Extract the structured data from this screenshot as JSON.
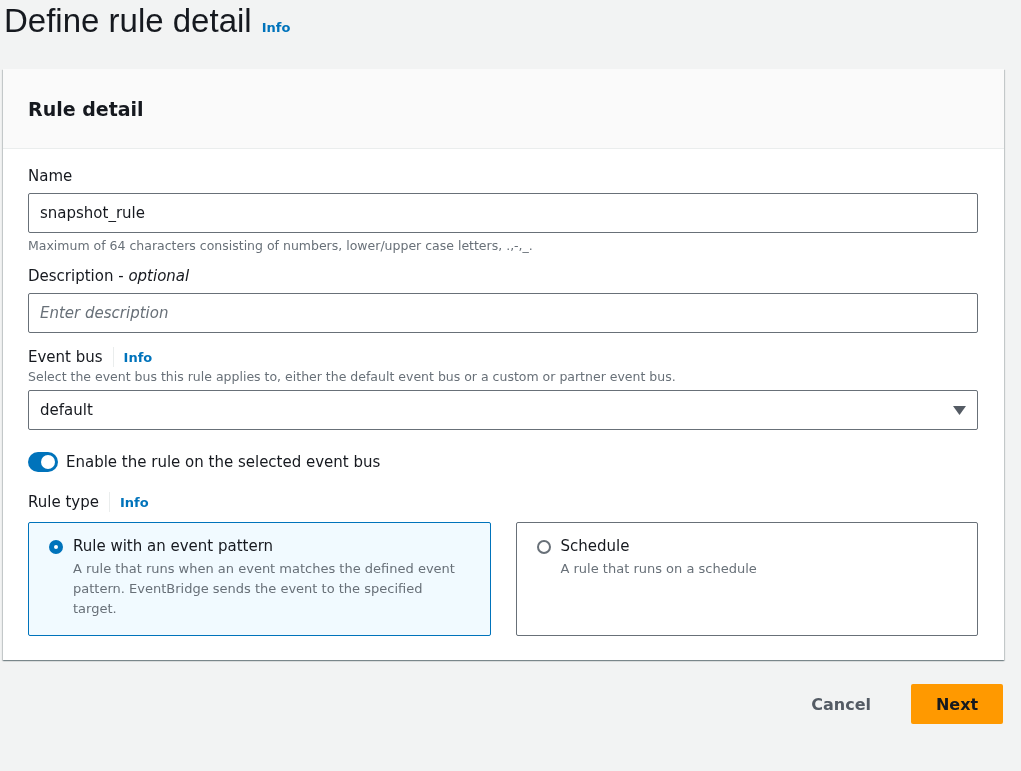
{
  "page": {
    "title": "Define rule detail",
    "info_link": "Info"
  },
  "card": {
    "title": "Rule detail",
    "name": {
      "label": "Name",
      "value": "snapshot_rule",
      "hint": "Maximum of 64 characters consisting of numbers, lower/upper case letters, .,-,_."
    },
    "description": {
      "label": "Description - *optional*",
      "placeholder": "Enter description"
    },
    "event_bus": {
      "label": "Event bus",
      "info_link": "Info",
      "hint": "Select the event bus this rule applies to, either the default event bus or a custom or partner event bus.",
      "value": "default"
    },
    "enable_toggle": {
      "label": "Enable the rule on the selected event bus",
      "on": true
    },
    "rule_type": {
      "label": "Rule type",
      "info_link": "Info",
      "options": [
        {
          "title": "Rule with an event pattern",
          "description": "A rule that runs when an event matches the defined event pattern. EventBridge sends the event to the specified target.",
          "selected": true
        },
        {
          "title": "Schedule",
          "description": "A rule that runs on a schedule",
          "selected": false
        }
      ]
    }
  },
  "buttons": [
    {
      "label": "Cancel",
      "kind": "link"
    },
    {
      "label": "Next",
      "kind": "primary"
    }
  ]
}
